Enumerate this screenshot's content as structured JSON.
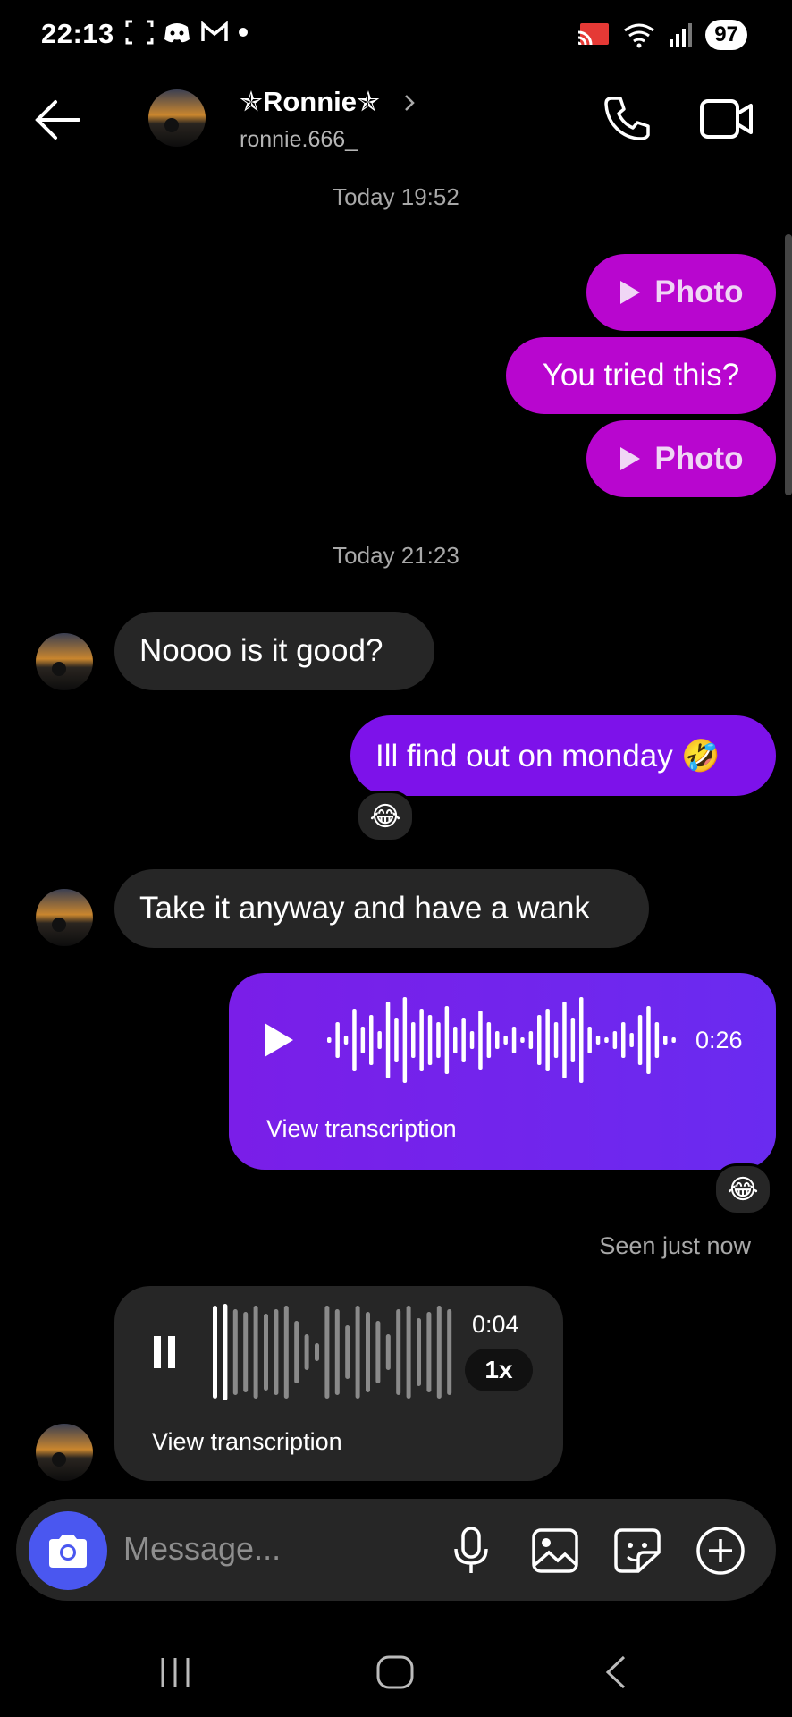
{
  "status_bar": {
    "time": "22:13",
    "battery": "97"
  },
  "header": {
    "name": "✯Ronnie✯",
    "username": "ronnie.666_"
  },
  "messages": {
    "ts1": "Today 19:52",
    "photo1": "Photo",
    "tried": "You tried this?",
    "photo2": "Photo",
    "ts2": "Today 21:23",
    "noooo": "Noooo is it good?",
    "monday": "Ill find out on monday 🤣",
    "monday_reaction": "😂",
    "take": "Take it anyway and have a wank",
    "voice_sent": {
      "duration": "0:26",
      "transcription": "View transcription",
      "reaction": "😂"
    },
    "seen": "Seen just now",
    "voice_recv": {
      "duration": "0:04",
      "speed": "1x",
      "transcription": "View transcription"
    }
  },
  "composer": {
    "placeholder": "Message..."
  },
  "colors": {
    "sent_pink": "#b806cf",
    "sent_purple": "#7d12ea",
    "received": "#262626",
    "camera": "#4a57f0"
  }
}
